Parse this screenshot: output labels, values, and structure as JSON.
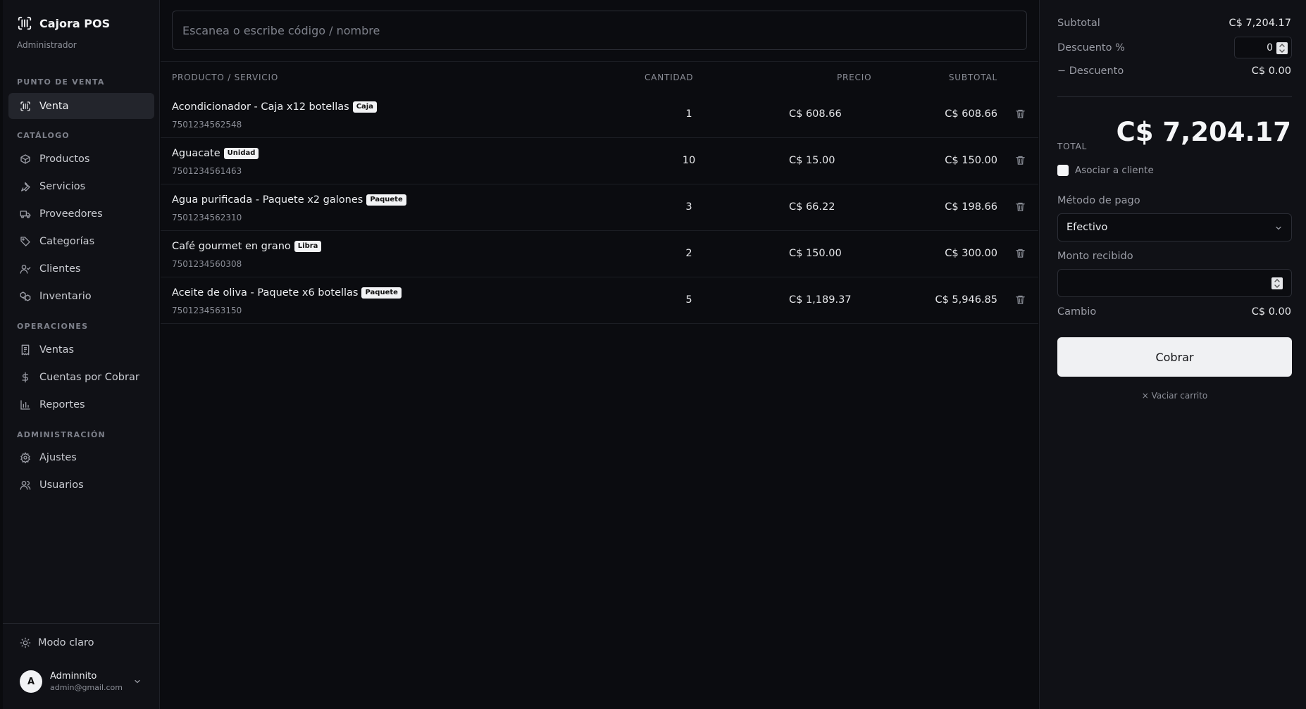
{
  "app": {
    "name": "Cajora POS",
    "role": "Administrador"
  },
  "sidebar": {
    "sections": [
      {
        "label": "PUNTO DE VENTA",
        "items": [
          {
            "label": "Venta",
            "icon": "scan-icon",
            "active": true
          }
        ]
      },
      {
        "label": "CATÁLOGO",
        "items": [
          {
            "label": "Productos",
            "icon": "box-icon"
          },
          {
            "label": "Servicios",
            "icon": "wrench-icon"
          },
          {
            "label": "Proveedores",
            "icon": "truck-icon"
          },
          {
            "label": "Categorías",
            "icon": "tag-icon"
          },
          {
            "label": "Clientes",
            "icon": "user-check-icon"
          },
          {
            "label": "Inventario",
            "icon": "boxes-icon"
          }
        ]
      },
      {
        "label": "OPERACIONES",
        "items": [
          {
            "label": "Ventas",
            "icon": "receipt-icon"
          },
          {
            "label": "Cuentas por Cobrar",
            "icon": "dollar-icon"
          },
          {
            "label": "Reportes",
            "icon": "bar-chart-icon"
          }
        ]
      },
      {
        "label": "ADMINISTRACIÓN",
        "items": [
          {
            "label": "Ajustes",
            "icon": "gear-icon"
          },
          {
            "label": "Usuarios",
            "icon": "users-icon"
          }
        ]
      }
    ],
    "mode_label": "Modo claro",
    "user": {
      "initial": "A",
      "name": "Adminnito",
      "email": "admin@gmail.com"
    }
  },
  "search": {
    "placeholder": "Escanea o escribe código / nombre",
    "value": ""
  },
  "table": {
    "headers": {
      "product": "PRODUCTO / SERVICIO",
      "qty": "CANTIDAD",
      "price": "PRECIO",
      "subtotal": "SUBTOTAL"
    },
    "rows": [
      {
        "name": "Acondicionador - Caja x12 botellas",
        "badge": "Caja",
        "code": "7501234562548",
        "qty": "1",
        "price": "C$ 608.66",
        "subtotal": "C$ 608.66"
      },
      {
        "name": "Aguacate",
        "badge": "Unidad",
        "code": "7501234561463",
        "qty": "10",
        "price": "C$ 15.00",
        "subtotal": "C$ 150.00"
      },
      {
        "name": "Agua purificada - Paquete x2 galones",
        "badge": "Paquete",
        "code": "7501234562310",
        "qty": "3",
        "price": "C$ 66.22",
        "subtotal": "C$ 198.66"
      },
      {
        "name": "Café gourmet en grano",
        "badge": "Libra",
        "code": "7501234560308",
        "qty": "2",
        "price": "C$ 150.00",
        "subtotal": "C$ 300.00"
      },
      {
        "name": "Aceite de oliva - Paquete x6 botellas",
        "badge": "Paquete",
        "code": "7501234563150",
        "qty": "5",
        "price": "C$ 1,189.37",
        "subtotal": "C$ 5,946.85"
      }
    ]
  },
  "summary": {
    "subtotal_label": "Subtotal",
    "subtotal_value": "C$ 7,204.17",
    "discount_pct_label": "Descuento %",
    "discount_pct_value": "0",
    "discount_label": "− Descuento",
    "discount_value": "C$ 0.00",
    "total_label": "TOTAL",
    "total_value": "C$ 7,204.17",
    "client_checkbox_label": "Asociar a cliente",
    "client_checked": false,
    "payment_label": "Método de pago",
    "payment_value": "Efectivo",
    "received_label": "Monto recibido",
    "received_value": "",
    "change_label": "Cambio",
    "change_value": "C$ 0.00",
    "charge_button": "Cobrar",
    "clear_cart": "× Vaciar carrito"
  }
}
